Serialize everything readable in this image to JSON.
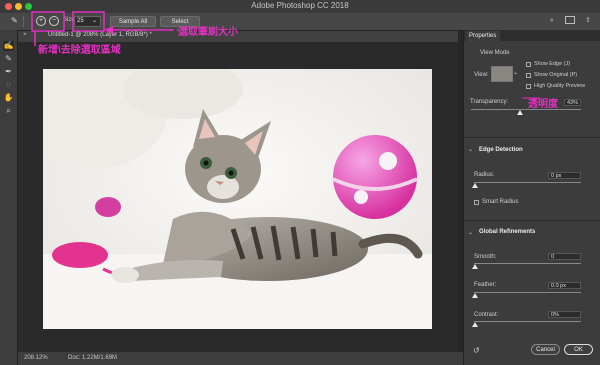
{
  "window": {
    "title": "Adobe Photoshop CC 2018"
  },
  "options_bar": {
    "size_label": "Size:",
    "size_value": "25",
    "sample_all_layers_label": "Sample All Layers",
    "select_subject_label": "Select Subject"
  },
  "document": {
    "tab_label": "Untitled-1 @ 208% (Layer 1, RGB/8*) *",
    "zoom": "208.12%",
    "doc_info": "Doc: 1.22M/1.69M"
  },
  "properties": {
    "tab_label": "Properties",
    "view_mode_label": "View Mode",
    "view_label": "View:",
    "show_edge_label": "Show Edge (J)",
    "show_original_label": "Show Original (P)",
    "high_quality_preview_label": "High Quality Preview",
    "transparency_label": "Transparency:",
    "transparency_value": "43%",
    "edge_detection_label": "Edge Detection",
    "radius_label": "Radius:",
    "radius_value": "0 px",
    "smart_radius_label": "Smart Radius",
    "global_refinements_label": "Global Refinements",
    "smooth_label": "Smooth:",
    "smooth_value": "0",
    "feather_label": "Feather:",
    "feather_value": "0.0 px",
    "contrast_label": "Contrast:",
    "contrast_value": "0%",
    "cancel_label": "Cancel",
    "ok_label": "OK"
  },
  "annotations": {
    "brush_size": "選取筆刷大小",
    "add_remove": "新增\\去除選取區域",
    "transparency": "透明度"
  },
  "colors": {
    "annotation": "#e52fc3",
    "panel_bg": "#3c3c3c",
    "canvas_bg": "#2a2a2a"
  }
}
